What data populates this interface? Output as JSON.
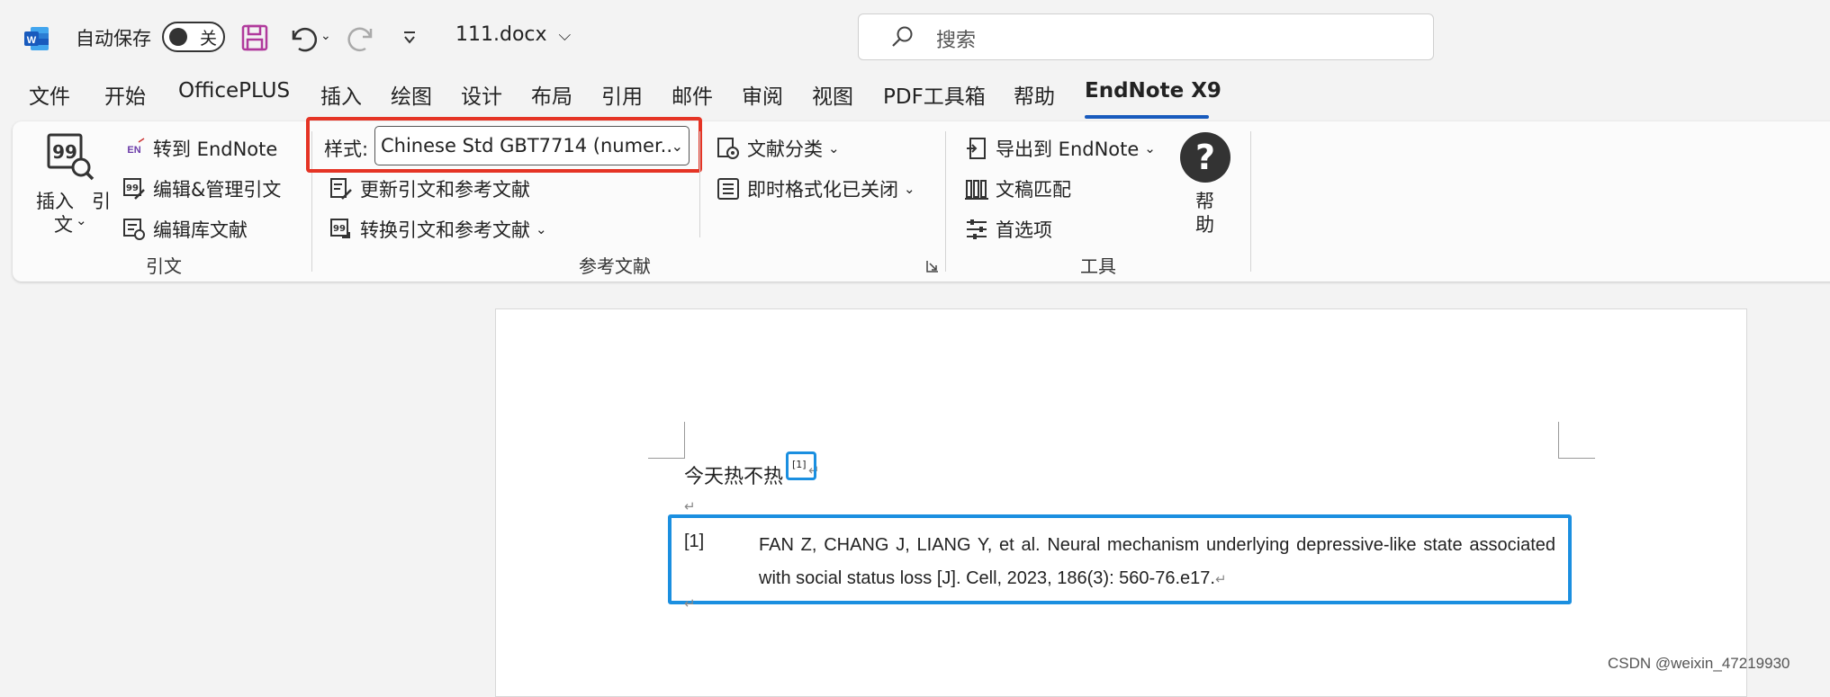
{
  "titlebar": {
    "app_icon": "word-icon",
    "autosave_label": "自动保存",
    "autosave_state": "关",
    "document_name": "111.docx",
    "search_placeholder": "搜索"
  },
  "tabs": [
    "文件",
    "开始",
    "OfficePLUS",
    "插入",
    "绘图",
    "设计",
    "布局",
    "引用",
    "邮件",
    "审阅",
    "视图",
    "PDF工具箱",
    "帮助",
    "EndNote X9"
  ],
  "active_tab": "EndNote X9",
  "ribbon": {
    "citations": {
      "insert_label_1": "插入",
      "insert_label_2": "引",
      "insert_label_3": "文",
      "goto_endnote": "转到 EndNote",
      "edit_manage": "编辑&管理引文",
      "edit_library": "编辑库文献",
      "group_label": "引文"
    },
    "bibliography": {
      "style_label": "样式:",
      "style_value": "Chinese Std GBT7714 (numer...",
      "update": "更新引文和参考文献",
      "convert": "转换引文和参考文献",
      "categorize": "文献分类",
      "instant_format": "即时格式化已关闭",
      "group_label": "参考文献"
    },
    "tools": {
      "export": "导出到 EndNote",
      "manuscript": "文稿匹配",
      "preferences": "首选项",
      "help_1": "帮",
      "help_2": "助",
      "group_label": "工具"
    }
  },
  "document": {
    "line1": "今天热不热",
    "citation": "[1]",
    "reference_number": "[1]",
    "reference_text": "FAN Z, CHANG J, LIANG Y, et al. Neural mechanism underlying depressive-like state associated with social status loss [J]. Cell, 2023, 186(3): 560-76.e17."
  },
  "watermark": "CSDN @weixin_47219930",
  "colors": {
    "word_blue": "#185abd",
    "highlight_red": "#e53425",
    "highlight_blue": "#1b8fe0"
  }
}
